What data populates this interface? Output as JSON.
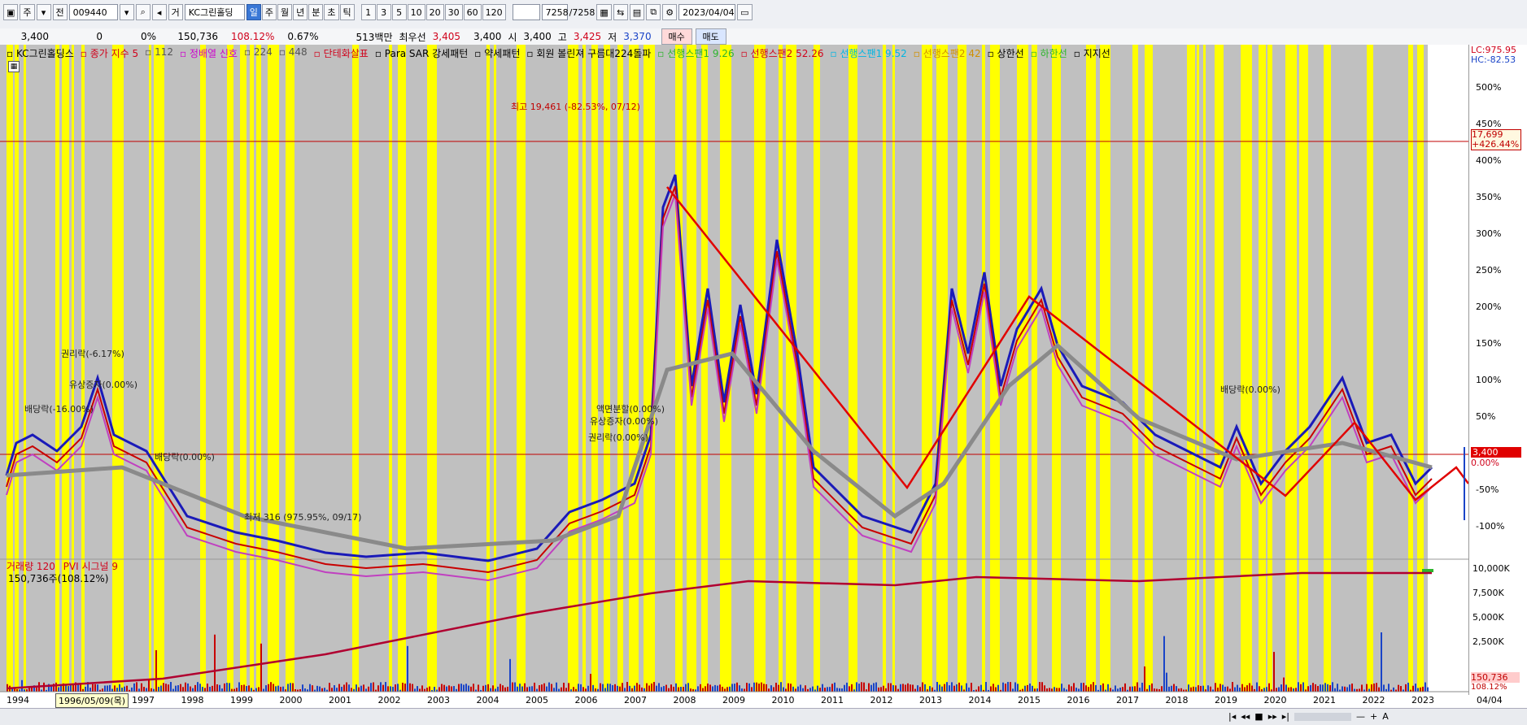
{
  "toolbar": {
    "period_label": "주",
    "code": "009440",
    "order_type": "거",
    "stock_name": "KC그린홀딩",
    "periods": [
      "일",
      "주",
      "월",
      "년",
      "분",
      "초",
      "틱"
    ],
    "active_period": "일",
    "numbers": [
      "1",
      "3",
      "5",
      "10",
      "20",
      "30",
      "60",
      "120"
    ],
    "counter": "7258",
    "counter_total": "/7258",
    "date": "2023/04/04"
  },
  "quote": {
    "price": "3,400",
    "change": "0",
    "change_pct": "0%",
    "volume": "150,736",
    "volume_ratio": "108.12%",
    "turnover_pct": "0.67%",
    "amount": "513백만",
    "best_label": "최우선",
    "best_price": "3,405",
    "ask": "3,400",
    "open_label": "시",
    "open": "3,400",
    "high_label": "고",
    "high": "3,425",
    "low_label": "저",
    "low": "3,370",
    "buy_button": "매수",
    "sell_button": "매도"
  },
  "legend": {
    "items": [
      {
        "text": "KC그린홀딩스",
        "color": "#000000"
      },
      {
        "text": "종가 지수 5",
        "color": "#d0021b"
      },
      {
        "text": "112",
        "color": "#555555"
      },
      {
        "text": "정배열 신호",
        "color": "#cc00cc"
      },
      {
        "text": "224",
        "color": "#555555"
      },
      {
        "text": "448",
        "color": "#555555"
      },
      {
        "text": "단테화살표",
        "color": "#d0021b"
      },
      {
        "text": "Para SAR 강세패턴",
        "color": "#000000"
      },
      {
        "text": "약세패턴",
        "color": "#000000"
      },
      {
        "text": "회원 볼린져 구름대224돌파",
        "color": "#000000"
      },
      {
        "text": "선행스팬1 9.26",
        "color": "#2db52d"
      },
      {
        "text": "선행스팬2 52.26",
        "color": "#d0021b"
      },
      {
        "text": "선행스팬1 9.52",
        "color": "#00b5e2"
      },
      {
        "text": "선행스팬2 42",
        "color": "#d09000"
      },
      {
        "text": "상한선",
        "color": "#000000"
      },
      {
        "text": "하한선",
        "color": "#2db52d"
      },
      {
        "text": "지지선",
        "color": "#000000"
      }
    ]
  },
  "axis_right": {
    "lc": "LC:975.95",
    "hc": "HC:-82.53",
    "pct_labels": [
      "500%",
      "450%",
      "400%",
      "350%",
      "300%",
      "250%",
      "200%",
      "150%",
      "100%",
      "50%",
      "0.00%",
      "-50%",
      "-100%"
    ],
    "hline_value": "17,699",
    "hline_pct": "+426.44%",
    "price_tag": "3,400",
    "zero_tag": "0.00%",
    "vol_labels": [
      "10,000K",
      "7,500K",
      "5,000K",
      "2,500K"
    ],
    "vol_tag": "150,736",
    "vol_pct_tag": "108.12%"
  },
  "volume_legend": {
    "label": "거래량 120",
    "pv": "PVI 시그널 9",
    "value": "150,736주(108.12%)"
  },
  "annotations": [
    {
      "text": "최고 19,461 (-82.53%, 07/12)"
    },
    {
      "text": "최저 316 (975.95%, 09/17)"
    },
    {
      "text": "권리락(-6.17%)"
    },
    {
      "text": "배당락(-16.00%)"
    },
    {
      "text": "유상증자(0.00%)"
    },
    {
      "text": "배당락(0.00%)"
    },
    {
      "text": "권리락(0.00%)"
    },
    {
      "text": "유상증자(0.00%)"
    },
    {
      "text": "액면분할(0.00%)"
    },
    {
      "text": "배당락(0.00%)"
    }
  ],
  "x_axis": {
    "years": [
      "1994",
      "1997",
      "1998",
      "1999",
      "2000",
      "2001",
      "2002",
      "2003",
      "2004",
      "2005",
      "2006",
      "2007",
      "2008",
      "2009",
      "2010",
      "2011",
      "2012",
      "2013",
      "2014",
      "2015",
      "2016",
      "2017",
      "2018",
      "2019",
      "2020",
      "2021",
      "2022",
      "2023"
    ],
    "cursor_date": "1996/05/09(목)",
    "right_label": "04/04"
  },
  "colors": {
    "band_yellow": "#ffff00",
    "band_gray": "#c0c0c0",
    "price_blue": "#1a1ab8",
    "price_red": "#c80000",
    "ma_gray": "#8a8a8a",
    "trend_red": "#e00000"
  }
}
